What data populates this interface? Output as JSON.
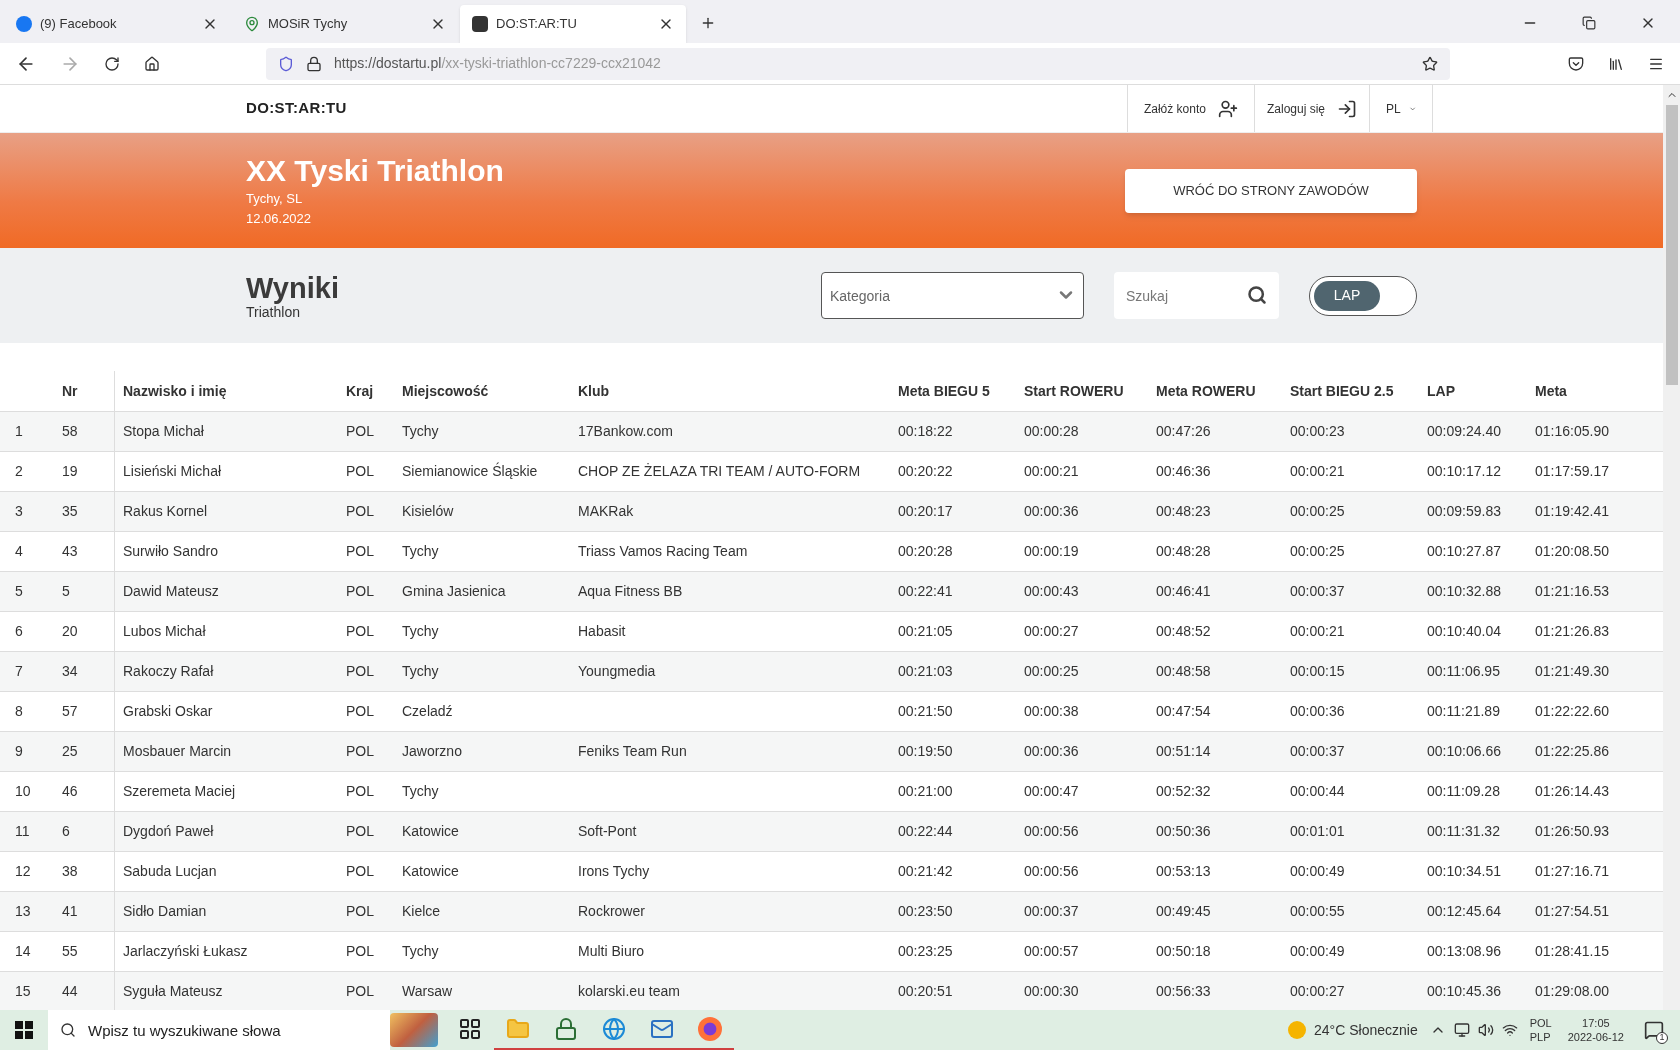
{
  "browser": {
    "tabs": [
      {
        "title": "(9) Facebook",
        "selected": false
      },
      {
        "title": "MOSiR Tychy",
        "selected": false
      },
      {
        "title": "DO:ST:AR:TU",
        "selected": true
      }
    ],
    "url_host": "https://dostartu.pl",
    "url_path": "/xx-tyski-triathlon-cc7229-ccx21042"
  },
  "site_header": {
    "logo": "DO:ST:AR:TU",
    "register": "Załóż konto",
    "login": "Zaloguj się",
    "language": "PL"
  },
  "banner": {
    "title": "XX Tyski Triathlon",
    "place": "Tychy, SL",
    "date": "12.06.2022",
    "back_button": "WRÓĆ DO STRONY ZAWODÓW"
  },
  "results_bar": {
    "title": "Wyniki",
    "subtitle": "Triathlon",
    "category": {
      "placeholder": "Kategoria"
    },
    "search": {
      "placeholder": "Szukaj"
    },
    "toggle": {
      "label": "LAP",
      "on": false
    }
  },
  "table": {
    "columns": [
      "",
      "Nr",
      "Nazwisko i imię",
      "Kraj",
      "Miejscowość",
      "Klub",
      "Meta BIEGU 5",
      "Start ROWERU",
      "Meta ROWERU",
      "Start BIEGU 2.5",
      "LAP",
      "Meta"
    ],
    "rows": [
      [
        "1",
        "58",
        "Stopa Michał",
        "POL",
        "Tychy",
        "17Bankow.com",
        "00:18:22",
        "00:00:28",
        "00:47:26",
        "00:00:23",
        "00:09:24.40",
        "01:16:05.90"
      ],
      [
        "2",
        "19",
        "Lisieński Michał",
        "POL",
        "Siemianowice Śląskie",
        "CHOP ZE ŻELAZA TRI TEAM / AUTO-FORM",
        "00:20:22",
        "00:00:21",
        "00:46:36",
        "00:00:21",
        "00:10:17.12",
        "01:17:59.17"
      ],
      [
        "3",
        "35",
        "Rakus Kornel",
        "POL",
        "Kisielów",
        "MAKRak",
        "00:20:17",
        "00:00:36",
        "00:48:23",
        "00:00:25",
        "00:09:59.83",
        "01:19:42.41"
      ],
      [
        "4",
        "43",
        "Surwiło Sandro",
        "POL",
        "Tychy",
        "Triass Vamos Racing Team",
        "00:20:28",
        "00:00:19",
        "00:48:28",
        "00:00:25",
        "00:10:27.87",
        "01:20:08.50"
      ],
      [
        "5",
        "5",
        "Dawid Mateusz",
        "POL",
        "Gmina Jasienica",
        "Aqua Fitness BB",
        "00:22:41",
        "00:00:43",
        "00:46:41",
        "00:00:37",
        "00:10:32.88",
        "01:21:16.53"
      ],
      [
        "6",
        "20",
        "Lubos Michał",
        "POL",
        "Tychy",
        "Habasit",
        "00:21:05",
        "00:00:27",
        "00:48:52",
        "00:00:21",
        "00:10:40.04",
        "01:21:26.83"
      ],
      [
        "7",
        "34",
        "Rakoczy Rafał",
        "POL",
        "Tychy",
        "Youngmedia",
        "00:21:03",
        "00:00:25",
        "00:48:58",
        "00:00:15",
        "00:11:06.95",
        "01:21:49.30"
      ],
      [
        "8",
        "57",
        "Grabski Oskar",
        "POL",
        "Czeladź",
        "",
        "00:21:50",
        "00:00:38",
        "00:47:54",
        "00:00:36",
        "00:11:21.89",
        "01:22:22.60"
      ],
      [
        "9",
        "25",
        "Mosbauer Marcin",
        "POL",
        "Jaworzno",
        "Feniks Team Run",
        "00:19:50",
        "00:00:36",
        "00:51:14",
        "00:00:37",
        "00:10:06.66",
        "01:22:25.86"
      ],
      [
        "10",
        "46",
        "Szeremeta Maciej",
        "POL",
        "Tychy",
        "",
        "00:21:00",
        "00:00:47",
        "00:52:32",
        "00:00:44",
        "00:11:09.28",
        "01:26:14.43"
      ],
      [
        "11",
        "6",
        "Dygdoń Paweł",
        "POL",
        "Katowice",
        "Soft-Pont",
        "00:22:44",
        "00:00:56",
        "00:50:36",
        "00:01:01",
        "00:11:31.32",
        "01:26:50.93"
      ],
      [
        "12",
        "38",
        "Sabuda Lucjan",
        "POL",
        "Katowice",
        "Irons Tychy",
        "00:21:42",
        "00:00:56",
        "00:53:13",
        "00:00:49",
        "00:10:34.51",
        "01:27:16.71"
      ],
      [
        "13",
        "41",
        "Sidło Damian",
        "POL",
        "Kielce",
        "Rockrower",
        "00:23:50",
        "00:00:37",
        "00:49:45",
        "00:00:55",
        "00:12:45.64",
        "01:27:54.51"
      ],
      [
        "14",
        "55",
        "Jarlaczyński Łukasz",
        "POL",
        "Tychy",
        "Multi Biuro",
        "00:23:25",
        "00:00:57",
        "00:50:18",
        "00:00:49",
        "00:13:08.96",
        "01:28:41.15"
      ],
      [
        "15",
        "44",
        "Syguła Mateusz",
        "POL",
        "Warsaw",
        "kolarski.eu team",
        "00:20:51",
        "00:00:30",
        "00:56:33",
        "00:00:27",
        "00:10:45.36",
        "01:29:08.00"
      ]
    ]
  },
  "taskbar": {
    "search": {
      "placeholder": "Wpisz tu wyszukiwane słowa"
    },
    "apps": [
      {
        "open": false
      },
      {
        "open": true
      },
      {
        "open": true
      },
      {
        "open": true
      },
      {
        "open": true
      },
      {
        "open": true
      }
    ],
    "weather": "24°C Słonecznie",
    "lang_top": "POL",
    "lang_bottom": "PLP",
    "time": "17:05",
    "date": "2022-06-12",
    "notifications": "1"
  }
}
